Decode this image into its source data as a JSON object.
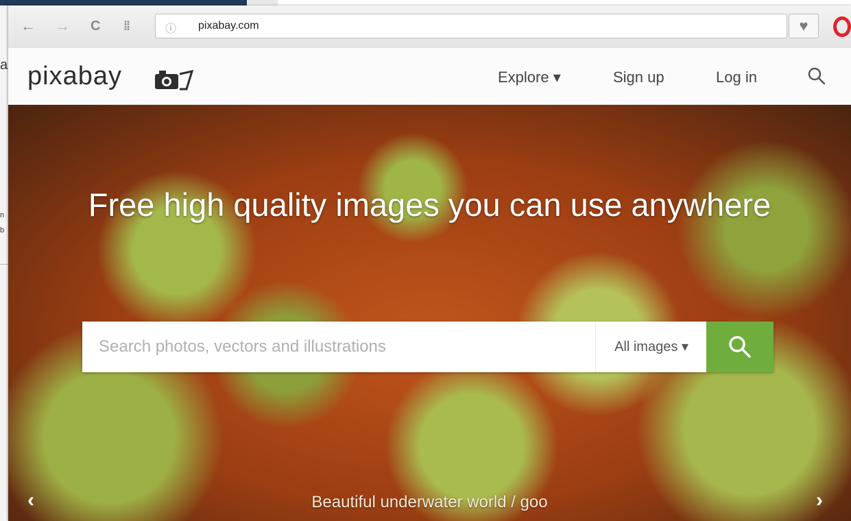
{
  "browser": {
    "url": "pixabay.com",
    "icons": {
      "back": "arrow-left-icon",
      "forward": "arrow-right-icon",
      "reload": "reload-icon",
      "speed_dial": "grid-icon",
      "site_info": "info-icon",
      "favorite": "heart-icon",
      "opera": "opera-logo-icon"
    },
    "icon_glyphs": {
      "back": "←",
      "forward": "→",
      "reload": "C",
      "speed_dial": "⁞⁞",
      "site_info": "ⓘ",
      "favorite": "♥"
    }
  },
  "background_window": {
    "fragments": [
      "a",
      "n",
      "b"
    ]
  },
  "header": {
    "logo": "pixabay",
    "nav": {
      "explore": "Explore ▾",
      "signup": "Sign up",
      "login": "Log in"
    },
    "search_icon": "search-icon"
  },
  "hero": {
    "title": "Free high quality images you can use anywhere",
    "search": {
      "placeholder": "Search photos, vectors and illustrations",
      "type_selected": "All images ▾"
    },
    "caption": "Beautiful underwater world / goo",
    "prev": "‹",
    "next": "›"
  },
  "colors": {
    "search_button": "#6fad3d",
    "opera_red": "#e0232b",
    "hero_base": "#c2551c"
  }
}
